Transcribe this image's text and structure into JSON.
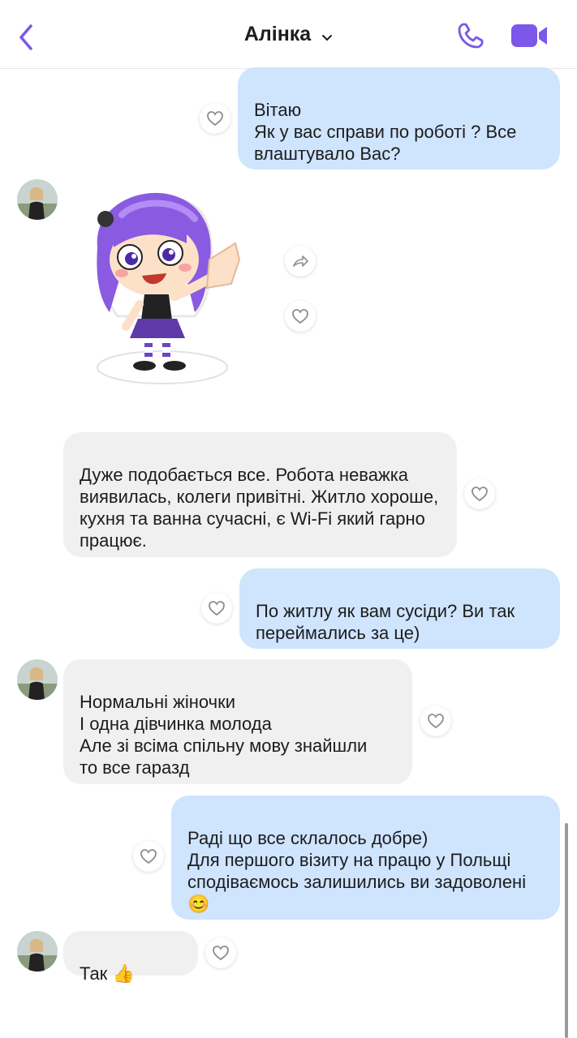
{
  "header": {
    "title": "Алінка",
    "accent": "#7b57ea"
  },
  "icons": {
    "back": "chevron-left-icon",
    "title_caret": "chevron-down-icon",
    "call": "phone-icon",
    "video": "video-camera-icon",
    "reaction": "heart-icon",
    "forward": "forward-arrow-icon"
  },
  "messages": [
    {
      "dir": "out",
      "text": "Вітаю\nЯк у вас справи по роботі ? Все влаштувало Вас?"
    },
    {
      "dir": "in",
      "type": "sticker",
      "sticker": "waving-girl-sticker"
    },
    {
      "dir": "in",
      "text": "Дуже подобається все. Робота неважка виявилась, колеги привітні. Житло хороше, кухня та ванна сучасні, є  Wi-Fi який гарно працює."
    },
    {
      "dir": "out",
      "text": "По житлу як вам сусіди? Ви так переймались за це)"
    },
    {
      "dir": "in",
      "text": "Нормальні жіночки\nІ одна дівчинка молода\nАле зі всіма спільну мову знайшли\nто все гаразд"
    },
    {
      "dir": "out",
      "text": "Раді що все склалось добре)\nДля першого візиту на працю у Польщі сподіваємось залишились ви задоволені ",
      "emoji": "😊"
    },
    {
      "dir": "in",
      "text": "Так ",
      "emoji": "👍"
    }
  ],
  "colors": {
    "outgoing_bubble": "#cfe4fd",
    "incoming_bubble": "#f0f0f1",
    "accent": "#7b57ea"
  }
}
